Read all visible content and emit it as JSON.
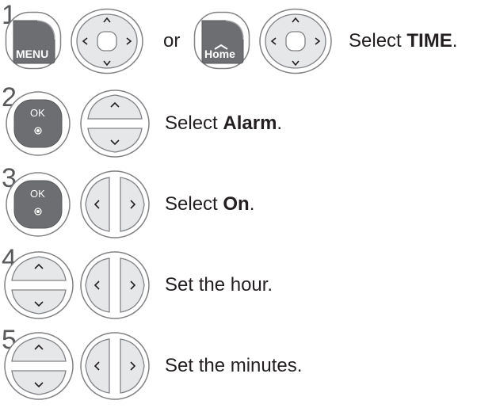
{
  "steps": [
    {
      "number": "1",
      "pre": "Select ",
      "bold": "TIME",
      "post": "."
    },
    {
      "number": "2",
      "pre": "Select ",
      "bold": "Alarm",
      "post": "."
    },
    {
      "number": "3",
      "pre": "Select ",
      "bold": "On",
      "post": "."
    },
    {
      "number": "4",
      "pre": "Set the hour.",
      "bold": "",
      "post": ""
    },
    {
      "number": "5",
      "pre": "Set the minutes.",
      "bold": "",
      "post": ""
    }
  ],
  "or_label": "or",
  "buttons": {
    "menu_label": "MENU",
    "home_label": "Home",
    "ok_label": "OK"
  },
  "colors": {
    "button_dark": "#6d6e71",
    "button_light": "#e6e7e8",
    "outline": "#808285",
    "step_number": "#58595b"
  }
}
